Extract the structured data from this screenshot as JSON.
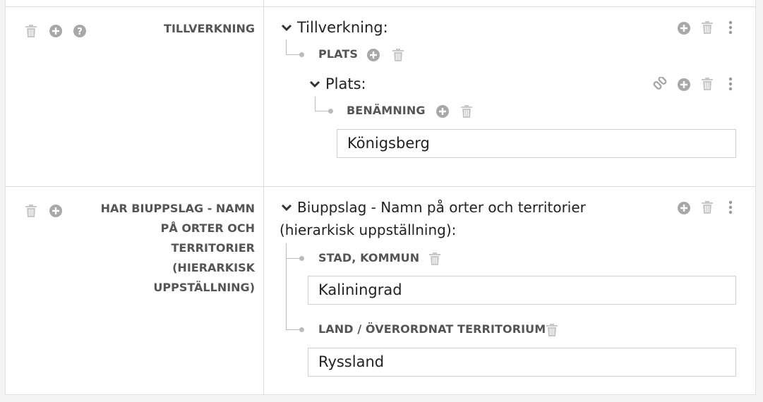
{
  "rows": [
    {
      "label": "TILLVERKNING",
      "heading": "Tillverkning:",
      "sub_label": "PLATS",
      "nested": {
        "heading": "Plats:",
        "field_label": "BENÄMNING",
        "field_value": "Königsberg"
      }
    },
    {
      "label_lines": [
        "HAR BIUPPSLAG - NAMN",
        "PÅ ORTER OCH",
        "TERRITORIER",
        "(HIERARKISK",
        "UPPSTÄLLNING)"
      ],
      "heading_lines": [
        "Biuppslag - Namn på orter och territorier",
        "(hierarkisk uppställning):"
      ],
      "fields": [
        {
          "label": "STAD, KOMMUN",
          "value": "Kaliningrad"
        },
        {
          "label": "LAND / ÖVERORDNAT TERRITORIUM",
          "value": "Ryssland"
        }
      ]
    }
  ],
  "icons": {
    "trash": "trash-icon",
    "add": "plus-circle-icon",
    "help": "question-circle-icon",
    "more": "more-vertical-icon",
    "link": "link-icon",
    "chevron": "chevron-down-icon"
  },
  "colors": {
    "icon_gray": "#b3b3b3",
    "icon_dark": "#9a9a9a",
    "border": "#dcdcdc"
  }
}
